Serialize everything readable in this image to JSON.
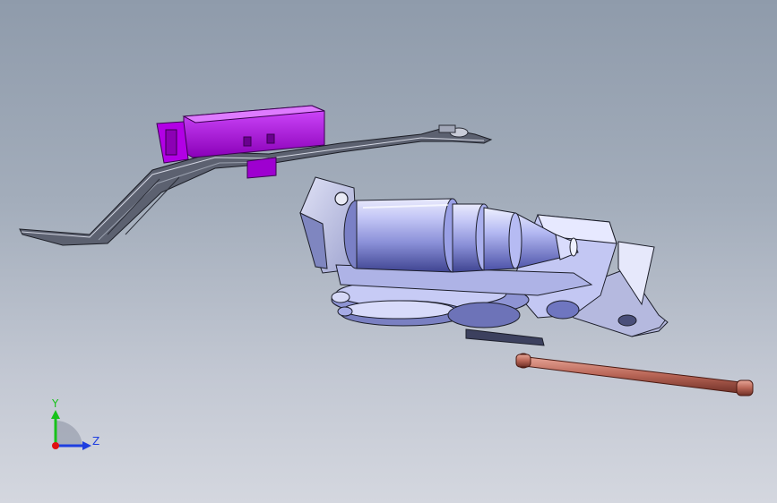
{
  "viewport": {
    "background_top": "#8f9bab",
    "background_bottom": "#d4d7df"
  },
  "model": {
    "parts": [
      {
        "name": "connector-housing",
        "color": "#b300e0"
      },
      {
        "name": "wiring-bracket",
        "color": "#4a4f5c"
      },
      {
        "name": "motor-body",
        "color": "#9aa0e6"
      },
      {
        "name": "gearbox-cover",
        "color": "#b8bdf0"
      },
      {
        "name": "mounting-plate",
        "color": "#c9cce9"
      },
      {
        "name": "gear-assembly",
        "color": "#7f86c8"
      },
      {
        "name": "shaft-rod",
        "color": "#c77263"
      }
    ]
  },
  "triad": {
    "y_label": "Y",
    "z_label": "Z",
    "y_color": "#17c21a",
    "z_color": "#1e3ee0",
    "origin_color": "#e01010"
  }
}
